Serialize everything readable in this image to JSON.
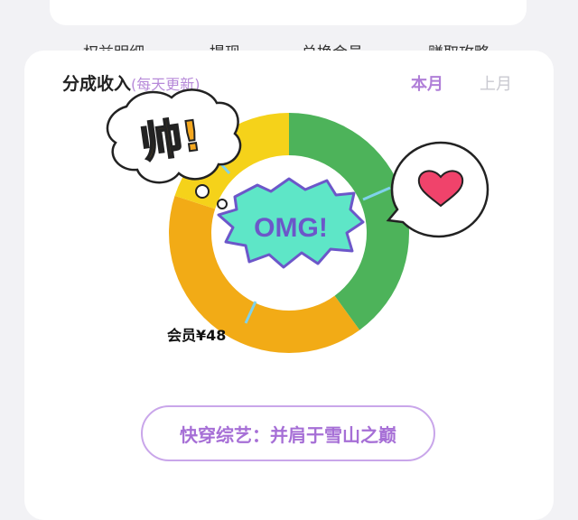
{
  "top_tabs": [
    "权益明细",
    "提现",
    "兑换会员",
    "赚取攻略"
  ],
  "section": {
    "title": "分成收入",
    "subtitle": "(每天更新)",
    "periods": [
      {
        "label": "本月",
        "active": true
      },
      {
        "label": "上月",
        "active": false
      }
    ]
  },
  "chart_data": {
    "type": "pie",
    "series": [
      {
        "label": "",
        "value": 48,
        "color": "#4db35a"
      },
      {
        "label": "会员¥48",
        "value": 48,
        "color": "#f2ab16"
      },
      {
        "label": "",
        "value": 24,
        "color": "#f5d21a"
      }
    ],
    "center_sticker": "OMG!"
  },
  "stickers": {
    "left": "帅!",
    "center": "OMG!",
    "right": "heart"
  },
  "show_button": "快穿综艺：并肩于雪山之巅",
  "colors": {
    "accent": "#b07fd8",
    "green": "#4db35a",
    "orange": "#f2ab16",
    "yellow": "#f5d21a",
    "teal_sticker": "#5ee6c7"
  }
}
